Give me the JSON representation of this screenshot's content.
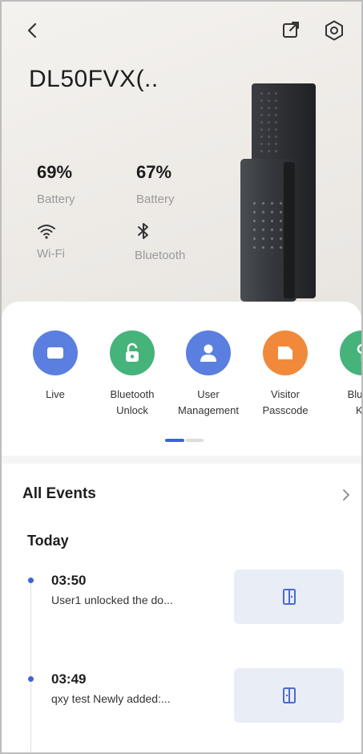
{
  "header": {
    "back_icon": "chevron-left-icon",
    "share_icon": "external-link-icon",
    "settings_icon": "settings-icon",
    "device_name": "DL50FVX(.."
  },
  "stats": {
    "battery_1": {
      "value": "69%",
      "label": "Battery"
    },
    "battery_2": {
      "value": "67%",
      "label": "Battery"
    },
    "wifi": {
      "icon": "wifi-icon",
      "label": "Wi-Fi"
    },
    "bluetooth": {
      "icon": "bluetooth-icon",
      "label": "Bluetooth"
    }
  },
  "actions": [
    {
      "label": "Live",
      "icon": "video-camera-icon",
      "color": "#5b7fe0"
    },
    {
      "label": "Bluetooth\nUnlock",
      "icon": "unlock-icon",
      "color": "#46b37a"
    },
    {
      "label": "User\nManagement",
      "icon": "user-icon",
      "color": "#5b7fe0"
    },
    {
      "label": "Visitor\nPasscode",
      "icon": "passcode-icon",
      "color": "#f08a3a"
    },
    {
      "label": "Blueto\nKe",
      "icon": "key-icon",
      "color": "#46b37a"
    }
  ],
  "events": {
    "title": "All Events",
    "day_label": "Today",
    "items": [
      {
        "time": "03:50",
        "description": "User1 unlocked the do..."
      },
      {
        "time": "03:49",
        "description": "qxy test Newly added:..."
      }
    ]
  },
  "colors": {
    "accent": "#3d63d9",
    "blue_action": "#5b7fe0",
    "green_action": "#46b37a",
    "orange_action": "#f08a3a"
  }
}
